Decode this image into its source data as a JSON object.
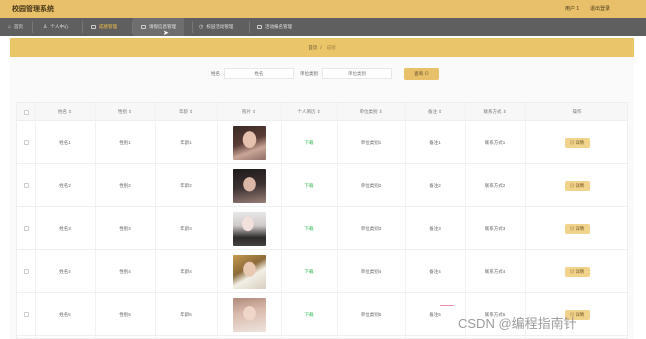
{
  "header": {
    "title": "校园管理系统",
    "user": "用户 1",
    "logout": "退出登录"
  },
  "nav": {
    "items": [
      {
        "label": "首页"
      },
      {
        "label": "个人中心"
      },
      {
        "label": "成绩管理"
      },
      {
        "label": "请假信息管理"
      },
      {
        "label": "校园活动管理"
      },
      {
        "label": "活动报名管理"
      }
    ]
  },
  "breadcrumb": {
    "home": "首页",
    "separator": "/",
    "current": "成绩"
  },
  "search": {
    "name_label": "姓名",
    "name_placeholder": "姓名",
    "type_label": "单位类别",
    "type_placeholder": "单位类别",
    "button_label": "查询 ⊙"
  },
  "table": {
    "columns": [
      "姓名 ⇕",
      "性别 ⇕",
      "年龄 ⇕",
      "照片 ⇕",
      "个人简历 ⇕",
      "单位类别 ⇕",
      "备注 ⇕",
      "联系方式 ⇕",
      "操作"
    ],
    "rows": [
      {
        "name": "姓名1",
        "gender": "性别1",
        "age": "年龄1",
        "resume": "下载",
        "unit": "单位类别1",
        "note": "备注1",
        "contact": "联系方式1",
        "action": "▤ 详情"
      },
      {
        "name": "姓名2",
        "gender": "性别2",
        "age": "年龄2",
        "resume": "下载",
        "unit": "单位类别2",
        "note": "备注2",
        "contact": "联系方式2",
        "action": "▤ 详情"
      },
      {
        "name": "姓名3",
        "gender": "性别3",
        "age": "年龄3",
        "resume": "下载",
        "unit": "单位类别3",
        "note": "备注3",
        "contact": "联系方式3",
        "action": "▤ 详情"
      },
      {
        "name": "姓名4",
        "gender": "性别4",
        "age": "年龄4",
        "resume": "下载",
        "unit": "单位类别4",
        "note": "备注4",
        "contact": "联系方式4",
        "action": "▤ 详情"
      },
      {
        "name": "姓名5",
        "gender": "性别5",
        "age": "年龄5",
        "resume": "下载",
        "unit": "单位类别5",
        "note": "备注5",
        "contact": "联系方式5",
        "action": "▤ 详情"
      }
    ]
  },
  "watermark": "CSDN @编程指南针",
  "colors": {
    "header": "#e8c06a",
    "nav": "#5f5f5f",
    "accent": "#f2d38b",
    "download": "#2db84d"
  }
}
